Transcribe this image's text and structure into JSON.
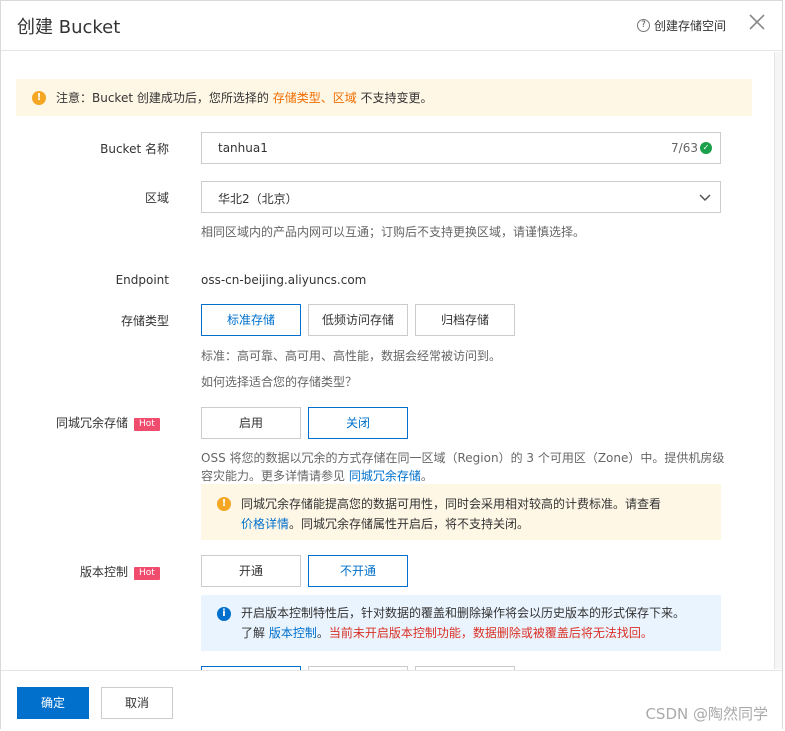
{
  "header": {
    "title": "创建 Bucket",
    "help_label": "创建存储空间"
  },
  "notice": {
    "prefix": "注意：Bucket 创建成功后，您所选择的 ",
    "highlight1": "存储类型",
    "sep": "、",
    "highlight2": "区域",
    "suffix": " 不支持变更。"
  },
  "bucket_name": {
    "label": "Bucket 名称",
    "value": "tanhua1",
    "counter": "7/63"
  },
  "region": {
    "label": "区域",
    "value": "华北2（北京）",
    "hint": "相同区域内的产品内网可以互通；订购后不支持更换区域，请谨慎选择。"
  },
  "endpoint": {
    "label": "Endpoint",
    "value": "oss-cn-beijing.aliyuncs.com"
  },
  "storage_type": {
    "label": "存储类型",
    "options": [
      "标准存储",
      "低频访问存储",
      "归档存储"
    ],
    "selected": "标准存储",
    "hint": "标准：高可靠、高可用、高性能，数据会经常被访问到。",
    "link": "如何选择适合您的存储类型？"
  },
  "zrs": {
    "label": "同城冗余存储",
    "badge": "Hot",
    "options": [
      "启用",
      "关闭"
    ],
    "selected": "关闭",
    "desc_line1": "OSS 将您的数据以冗余的方式存储在同一区域（Region）的 3 个可用区（Zone）中。提供机房级",
    "desc_line2_prefix": "容灾能力。更多详情请参见 ",
    "desc_link": "同城冗余存储",
    "desc_line2_suffix": "。",
    "warn_line1": "同城冗余存储能提高您的数据可用性，同时会采用相对较高的计费标准。请查看",
    "warn_link": "价格详情",
    "warn_line2": "。同城冗余存储属性开启后，将不支持关闭。"
  },
  "versioning": {
    "label": "版本控制",
    "badge": "Hot",
    "options": [
      "开通",
      "不开通"
    ],
    "selected": "不开通",
    "info_line1": "开启版本控制特性后，针对数据的覆盖和删除操作将会以历史版本的形式保存下来。",
    "info_prefix": "了解 ",
    "info_link": "版本控制",
    "info_sep": "。",
    "info_red": "当前未开启版本控制功能，数据删除或被覆盖后将无法找回。"
  },
  "footer": {
    "confirm": "确定",
    "cancel": "取消",
    "watermark": "CSDN @陶然同学"
  },
  "colors": {
    "primary": "#0070cc",
    "warning_bg": "#fff7e6",
    "info_bg": "#eaf4fe",
    "hot": "#f04c6e",
    "highlight": "#f06d00",
    "danger": "#d93026"
  }
}
